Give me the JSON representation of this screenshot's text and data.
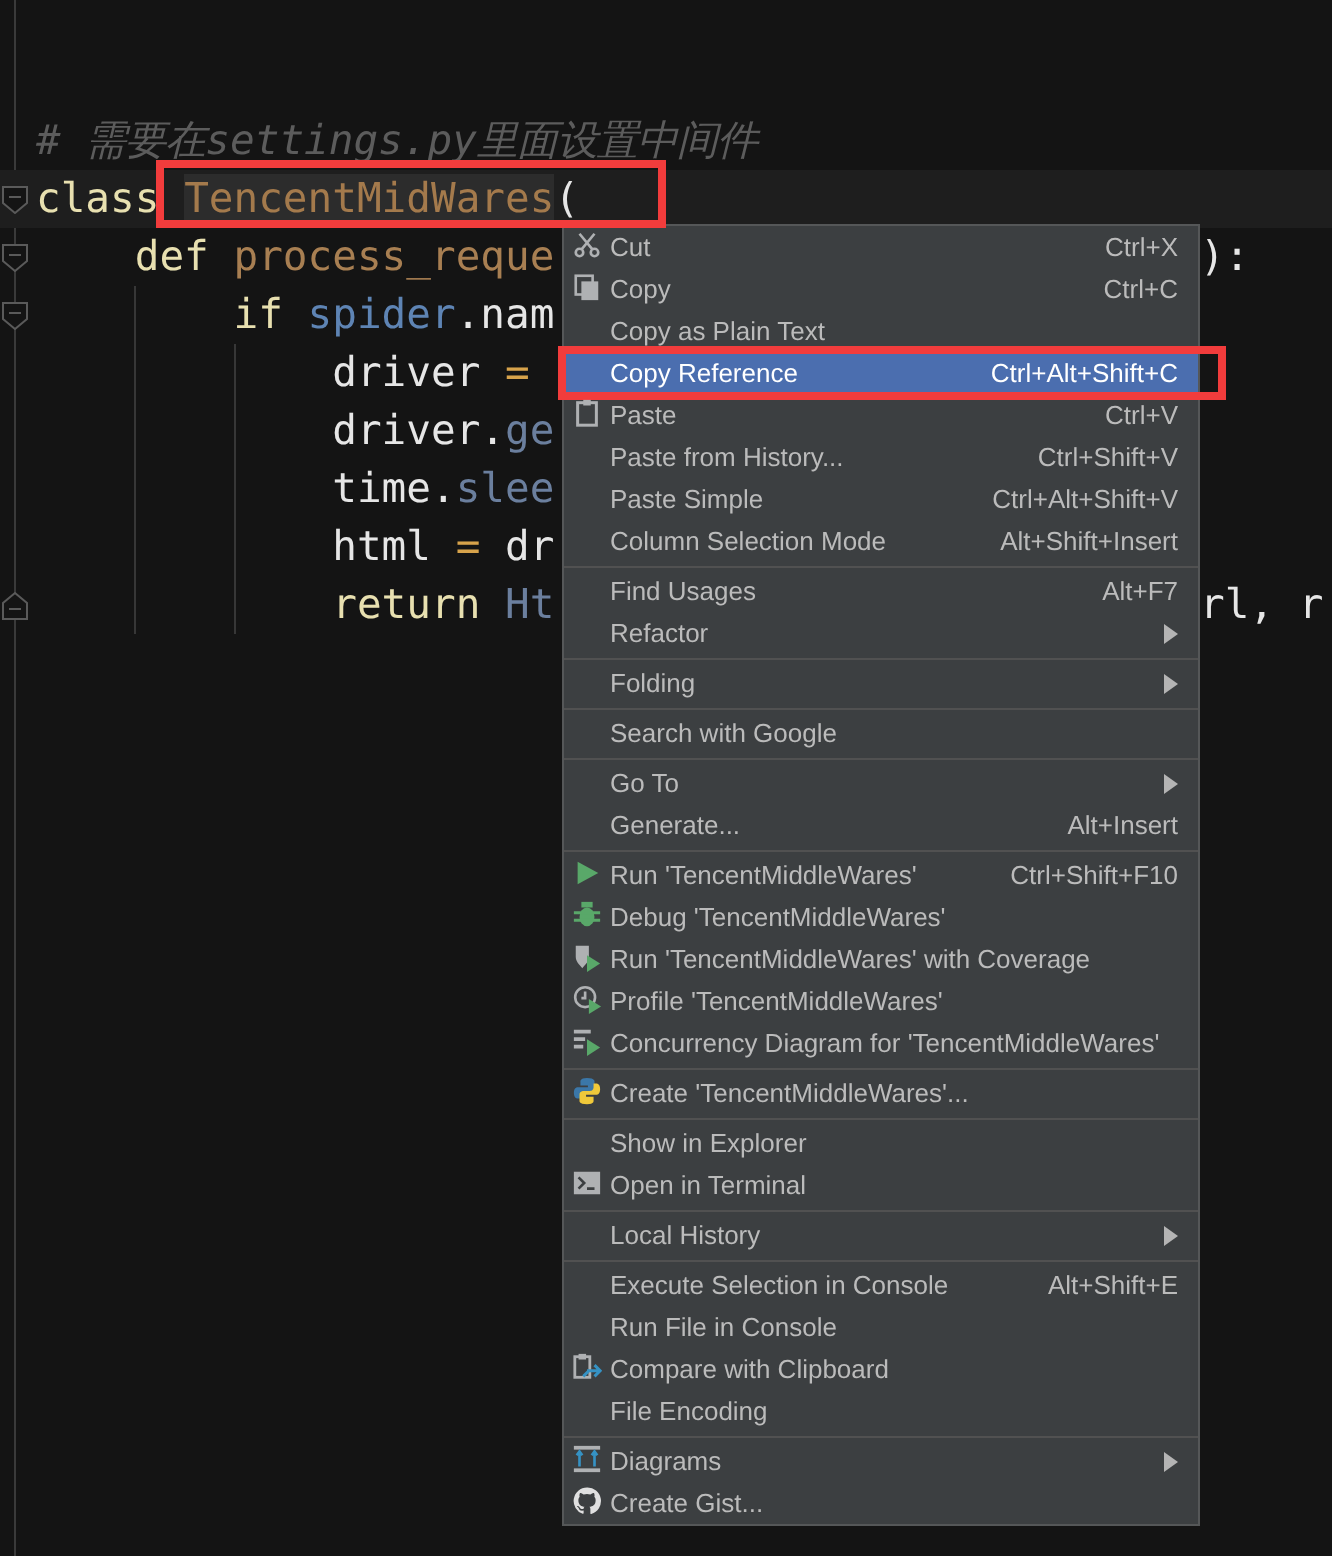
{
  "editor": {
    "lines": [
      {
        "current": false,
        "fold_start": false,
        "fold_end": false,
        "left": [
          {
            "kind": "comment",
            "text": "# 需要在settings.py里面设置中间件"
          }
        ]
      },
      {
        "current": true,
        "fold_start": true,
        "fold_end": false,
        "left": [
          {
            "kind": "keyword",
            "text": "class "
          },
          {
            "kind": "classname",
            "text": "TencentMidWares",
            "annotated": true
          },
          {
            "kind": "plain",
            "text": "("
          }
        ]
      },
      {
        "current": false,
        "fold_start": true,
        "fold_end": false,
        "left": [
          {
            "kind": "keyword",
            "text": "    def "
          },
          {
            "kind": "funcname",
            "text": "process_reque"
          }
        ],
        "right": [
          {
            "kind": "plain",
            "text": "):"
          }
        ]
      },
      {
        "current": false,
        "fold_start": true,
        "fold_end": false,
        "left": [
          {
            "kind": "keyword",
            "text": "        if "
          },
          {
            "kind": "param",
            "text": "spider"
          },
          {
            "kind": "plain",
            "text": ".nam"
          }
        ]
      },
      {
        "current": false,
        "fold_start": false,
        "fold_end": false,
        "left": [
          {
            "kind": "plain",
            "text": "            driver "
          },
          {
            "kind": "op",
            "text": "="
          }
        ]
      },
      {
        "current": false,
        "fold_start": false,
        "fold_end": false,
        "left": [
          {
            "kind": "plain",
            "text": "            driver."
          },
          {
            "kind": "attr",
            "text": "ge"
          }
        ]
      },
      {
        "current": false,
        "fold_start": false,
        "fold_end": false,
        "left": [
          {
            "kind": "plain",
            "text": "            time."
          },
          {
            "kind": "attr",
            "text": "slee"
          }
        ]
      },
      {
        "current": false,
        "fold_start": false,
        "fold_end": false,
        "left": [
          {
            "kind": "plain",
            "text": "            html "
          },
          {
            "kind": "op",
            "text": "="
          },
          {
            "kind": "plain",
            "text": " dr"
          }
        ]
      },
      {
        "current": false,
        "fold_start": false,
        "fold_end": true,
        "left": [
          {
            "kind": "keyword",
            "text": "            return "
          },
          {
            "kind": "attr",
            "text": "Ht"
          }
        ],
        "right": [
          {
            "kind": "plain",
            "text": "rl, r"
          }
        ]
      }
    ]
  },
  "context_menu": {
    "items": [
      {
        "kind": "cut",
        "label": "Cut",
        "shortcut": "Ctrl+X",
        "submenu": false,
        "selected": false,
        "annotated": false
      },
      {
        "kind": "copy",
        "label": "Copy",
        "shortcut": "Ctrl+C",
        "submenu": false,
        "selected": false,
        "annotated": false
      },
      {
        "kind": "plain",
        "label": "Copy as Plain Text",
        "submenu": false,
        "selected": false,
        "annotated": false
      },
      {
        "kind": "plain",
        "label": "Copy Reference",
        "shortcut": "Ctrl+Alt+Shift+C",
        "submenu": false,
        "selected": true,
        "annotated": true
      },
      {
        "kind": "paste",
        "label": "Paste",
        "shortcut": "Ctrl+V",
        "submenu": false,
        "selected": false,
        "annotated": false
      },
      {
        "kind": "plain",
        "label": "Paste from History...",
        "shortcut": "Ctrl+Shift+V",
        "submenu": false,
        "selected": false,
        "annotated": false
      },
      {
        "kind": "plain",
        "label": "Paste Simple",
        "shortcut": "Ctrl+Alt+Shift+V",
        "submenu": false,
        "selected": false,
        "annotated": false
      },
      {
        "kind": "plain",
        "label": "Column Selection Mode",
        "shortcut": "Alt+Shift+Insert",
        "submenu": false,
        "selected": false,
        "annotated": false
      },
      {
        "kind": "separator"
      },
      {
        "kind": "plain",
        "label": "Find Usages",
        "shortcut": "Alt+F7",
        "submenu": false,
        "selected": false,
        "annotated": false
      },
      {
        "kind": "plain",
        "label": "Refactor",
        "submenu": true,
        "selected": false,
        "annotated": false
      },
      {
        "kind": "separator"
      },
      {
        "kind": "plain",
        "label": "Folding",
        "submenu": true,
        "selected": false,
        "annotated": false
      },
      {
        "kind": "separator"
      },
      {
        "kind": "plain",
        "label": "Search with Google",
        "submenu": false,
        "selected": false,
        "annotated": false
      },
      {
        "kind": "separator"
      },
      {
        "kind": "plain",
        "label": "Go To",
        "submenu": true,
        "selected": false,
        "annotated": false
      },
      {
        "kind": "plain",
        "label": "Generate...",
        "shortcut": "Alt+Insert",
        "submenu": false,
        "selected": false,
        "annotated": false
      },
      {
        "kind": "separator"
      },
      {
        "kind": "run",
        "label": "Run 'TencentMiddleWares'",
        "shortcut": "Ctrl+Shift+F10",
        "submenu": false,
        "selected": false,
        "annotated": false
      },
      {
        "kind": "debug",
        "label": "Debug 'TencentMiddleWares'",
        "submenu": false,
        "selected": false,
        "annotated": false
      },
      {
        "kind": "coverage",
        "label": "Run 'TencentMiddleWares' with Coverage",
        "submenu": false,
        "selected": false,
        "annotated": false
      },
      {
        "kind": "profile",
        "label": "Profile 'TencentMiddleWares'",
        "submenu": false,
        "selected": false,
        "annotated": false
      },
      {
        "kind": "concurrency",
        "label": "Concurrency Diagram for 'TencentMiddleWares'",
        "submenu": false,
        "selected": false,
        "annotated": false
      },
      {
        "kind": "separator"
      },
      {
        "kind": "python",
        "label": "Create 'TencentMiddleWares'...",
        "submenu": false,
        "selected": false,
        "annotated": false
      },
      {
        "kind": "separator"
      },
      {
        "kind": "plain",
        "label": "Show in Explorer",
        "submenu": false,
        "selected": false,
        "annotated": false
      },
      {
        "kind": "terminal",
        "label": "Open in Terminal",
        "submenu": false,
        "selected": false,
        "annotated": false
      },
      {
        "kind": "separator"
      },
      {
        "kind": "plain",
        "label": "Local History",
        "submenu": true,
        "selected": false,
        "annotated": false
      },
      {
        "kind": "separator"
      },
      {
        "kind": "plain",
        "label": "Execute Selection in Console",
        "shortcut": "Alt+Shift+E",
        "submenu": false,
        "selected": false,
        "annotated": false
      },
      {
        "kind": "plain",
        "label": "Run File in Console",
        "submenu": false,
        "selected": false,
        "annotated": false
      },
      {
        "kind": "compare",
        "label": "Compare with Clipboard",
        "submenu": false,
        "selected": false,
        "annotated": false
      },
      {
        "kind": "plain",
        "label": "File Encoding",
        "submenu": false,
        "selected": false,
        "annotated": false
      },
      {
        "kind": "separator"
      },
      {
        "kind": "diagrams",
        "label": "Diagrams",
        "submenu": true,
        "selected": false,
        "annotated": false
      },
      {
        "kind": "github",
        "label": "Create Gist...",
        "submenu": false,
        "selected": false,
        "annotated": false
      }
    ]
  }
}
